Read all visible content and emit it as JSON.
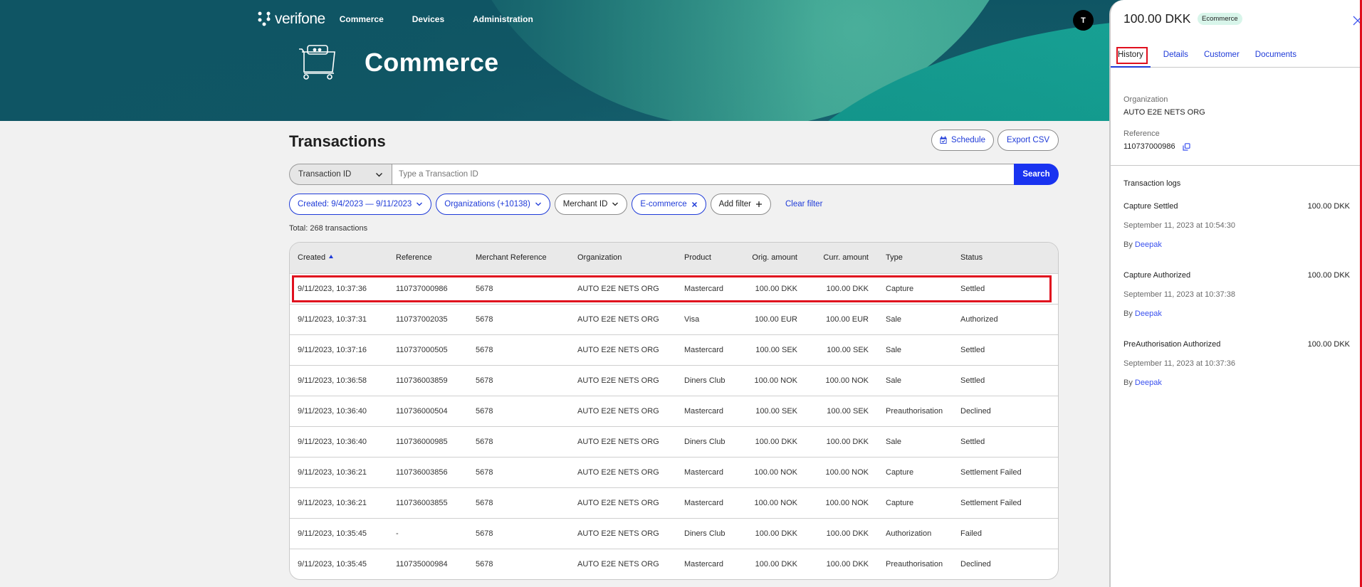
{
  "header": {
    "brand": "verifone",
    "nav": [
      "Commerce",
      "Devices",
      "Administration"
    ],
    "hero_title": "Commerce",
    "user_initial": "T"
  },
  "page": {
    "title": "Transactions",
    "schedule_label": "Schedule",
    "export_label": "Export CSV"
  },
  "search": {
    "field_select": "Transaction ID",
    "placeholder": "Type a Transaction ID",
    "value": "",
    "button_label": "Search"
  },
  "filters": {
    "created": "Created: 9/4/2023 — 9/11/2023",
    "organizations": "Organizations (+10138)",
    "merchant_id": "Merchant ID",
    "ecommerce": "E-commerce",
    "add_filter": "Add filter",
    "clear_filter": "Clear filter"
  },
  "total_text": "Total: 268 transactions",
  "table": {
    "columns": [
      "Created",
      "Reference",
      "Merchant Reference",
      "Organization",
      "Product",
      "Orig. amount",
      "Curr. amount",
      "Type",
      "Status"
    ],
    "rows": [
      [
        "9/11/2023, 10:37:36",
        "110737000986",
        "5678",
        "AUTO E2E NETS ORG",
        "Mastercard",
        "100.00 DKK",
        "100.00 DKK",
        "Capture",
        "Settled"
      ],
      [
        "9/11/2023, 10:37:31",
        "110737002035",
        "5678",
        "AUTO E2E NETS ORG",
        "Visa",
        "100.00 EUR",
        "100.00 EUR",
        "Sale",
        "Authorized"
      ],
      [
        "9/11/2023, 10:37:16",
        "110737000505",
        "5678",
        "AUTO E2E NETS ORG",
        "Mastercard",
        "100.00 SEK",
        "100.00 SEK",
        "Sale",
        "Settled"
      ],
      [
        "9/11/2023, 10:36:58",
        "110736003859",
        "5678",
        "AUTO E2E NETS ORG",
        "Diners Club",
        "100.00 NOK",
        "100.00 NOK",
        "Sale",
        "Settled"
      ],
      [
        "9/11/2023, 10:36:40",
        "110736000504",
        "5678",
        "AUTO E2E NETS ORG",
        "Mastercard",
        "100.00 SEK",
        "100.00 SEK",
        "Preauthorisation",
        "Declined"
      ],
      [
        "9/11/2023, 10:36:40",
        "110736000985",
        "5678",
        "AUTO E2E NETS ORG",
        "Diners Club",
        "100.00 DKK",
        "100.00 DKK",
        "Sale",
        "Settled"
      ],
      [
        "9/11/2023, 10:36:21",
        "110736003856",
        "5678",
        "AUTO E2E NETS ORG",
        "Mastercard",
        "100.00 NOK",
        "100.00 NOK",
        "Capture",
        "Settlement Failed"
      ],
      [
        "9/11/2023, 10:36:21",
        "110736003855",
        "5678",
        "AUTO E2E NETS ORG",
        "Mastercard",
        "100.00 NOK",
        "100.00 NOK",
        "Capture",
        "Settlement Failed"
      ],
      [
        "9/11/2023, 10:35:45",
        "-",
        "5678",
        "AUTO E2E NETS ORG",
        "Diners Club",
        "100.00 DKK",
        "100.00 DKK",
        "Authorization",
        "Failed"
      ],
      [
        "9/11/2023, 10:35:45",
        "110735000984",
        "5678",
        "AUTO E2E NETS ORG",
        "Mastercard",
        "100.00 DKK",
        "100.00 DKK",
        "Preauthorisation",
        "Declined"
      ]
    ]
  },
  "panel": {
    "amount": "100.00 DKK",
    "badge": "Ecommerce",
    "tabs": [
      "History",
      "Details",
      "Customer",
      "Documents"
    ],
    "active_tab": "History",
    "organization_label": "Organization",
    "organization_value": "AUTO E2E NETS ORG",
    "reference_label": "Reference",
    "reference_value": "110737000986",
    "logs_title": "Transaction logs",
    "logs": [
      {
        "event": "Capture Settled",
        "amount": "100.00 DKK",
        "date": "September 11, 2023 at 10:54:30",
        "by_prefix": "By",
        "user": "Deepak"
      },
      {
        "event": "Capture Authorized",
        "amount": "100.00 DKK",
        "date": "September 11, 2023 at 10:37:38",
        "by_prefix": "By",
        "user": "Deepak"
      },
      {
        "event": "PreAuthorisation Authorized",
        "amount": "100.00 DKK",
        "date": "September 11, 2023 at 10:37:36",
        "by_prefix": "By",
        "user": "Deepak"
      }
    ]
  },
  "colors": {
    "accent": "#1f3bd8",
    "search_button": "#1933f0",
    "highlight": "#e0101e",
    "hero": "#0f5564",
    "badge_bg": "#d8f5ea"
  },
  "icons": {
    "logo": "verifone-dots-icon",
    "hero": "shopping-cart-icon",
    "schedule": "calendar-icon",
    "copy": "copy-icon",
    "close": "close-icon"
  }
}
